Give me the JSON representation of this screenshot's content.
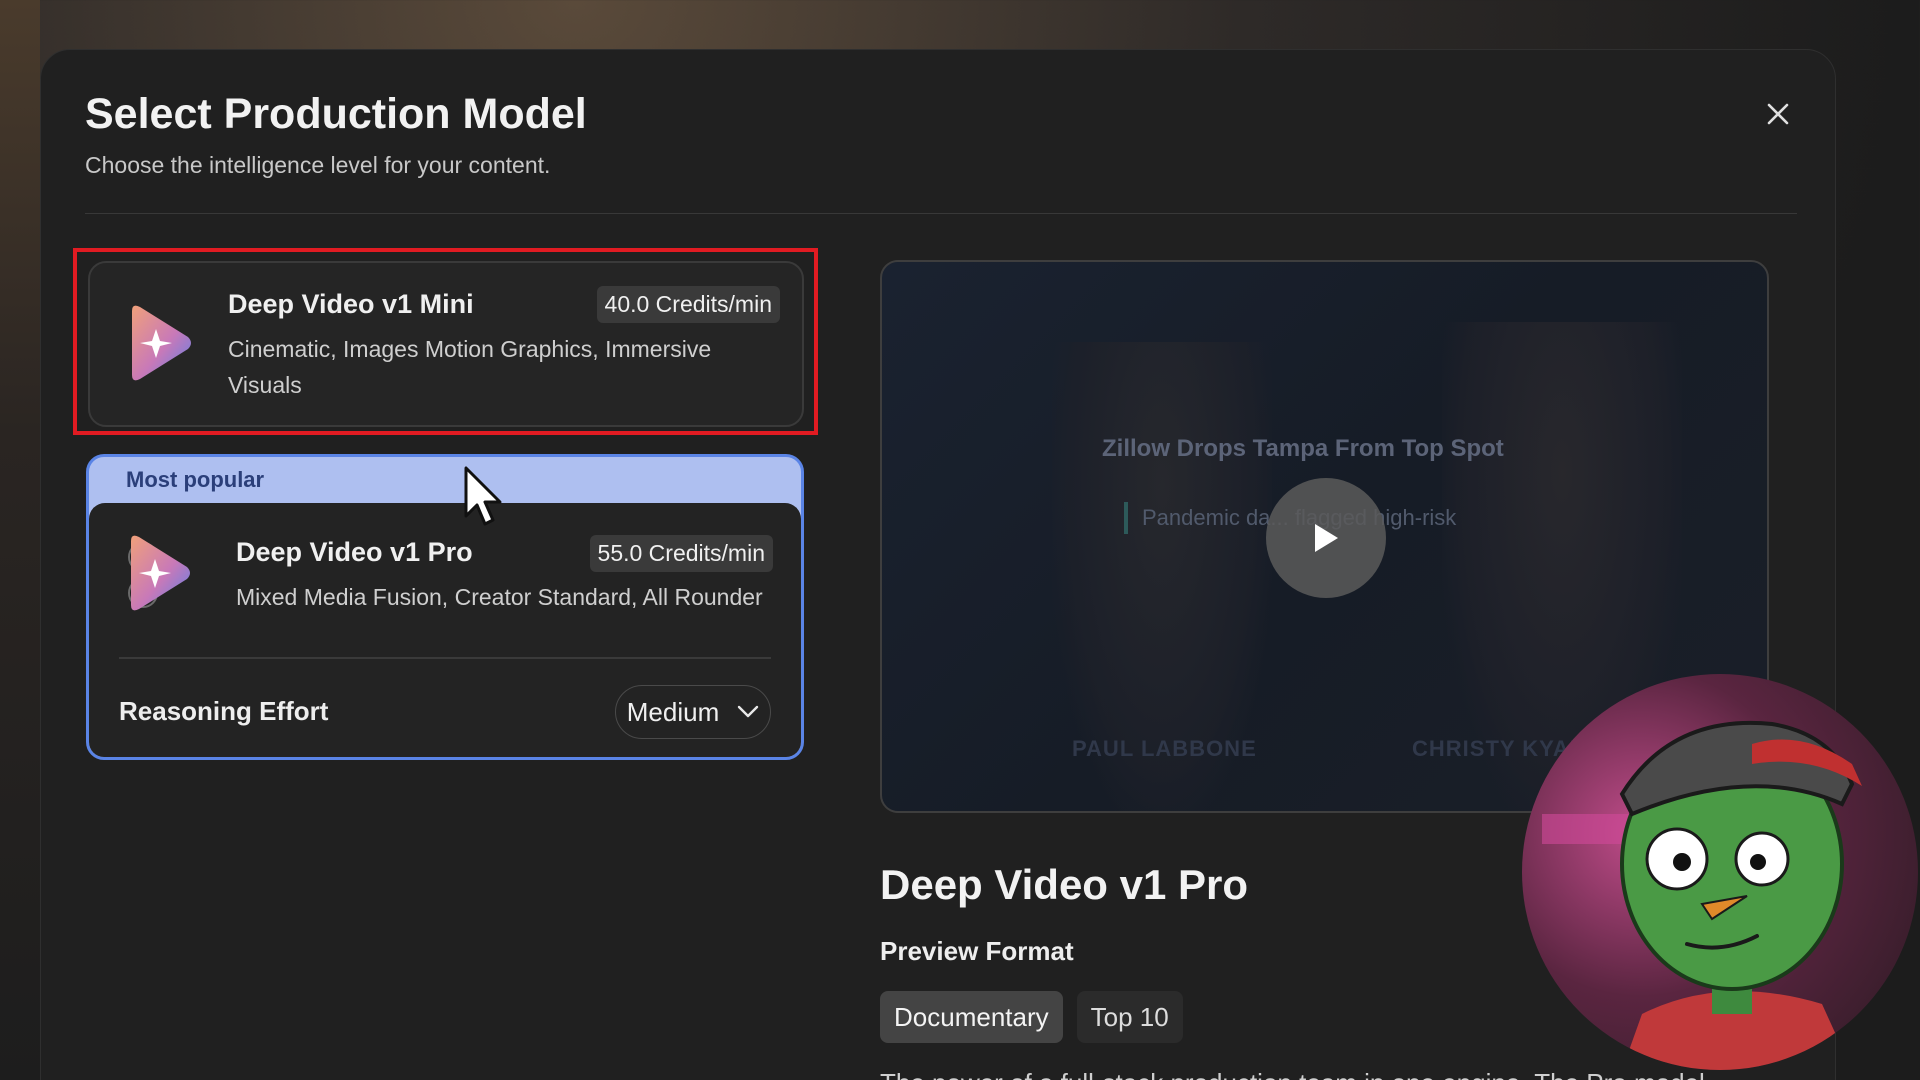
{
  "modal": {
    "title": "Select Production Model",
    "subtitle": "Choose the intelligence level for your content."
  },
  "models": [
    {
      "name": "Deep Video v1 Mini",
      "credits": "40.0 Credits/min",
      "description": "Cinematic, Images Motion Graphics, Immersive Visuals",
      "icon": "sparkle-play-icon"
    },
    {
      "badge": "Most popular",
      "name": "Deep Video v1 Pro",
      "credits": "55.0 Credits/min",
      "description": "Mixed Media Fusion, Creator Standard, All Rounder",
      "icon": "sparkle-play-icon",
      "reasoning_label": "Reasoning Effort",
      "reasoning_value": "Medium"
    }
  ],
  "preview": {
    "video_headline": "Zillow Drops Tampa From Top Spot",
    "video_subtext": "Pandemic da... flagged high-risk",
    "video_lower_left": "PAUL LABBONE",
    "video_lower_right": "CHRISTY KYAR",
    "selected_model": "Deep Video v1 Pro",
    "section_label": "Preview Format",
    "formats": [
      "Documentary",
      "Top 10"
    ],
    "active_format": "Documentary",
    "description": "The power of a full-stack production team in one engine. The Pro model"
  },
  "colors": {
    "highlight": "#e11b22",
    "popular_bg": "#aebff0",
    "popular_border": "#5a84e6",
    "popular_text": "#2b3f7a",
    "modal_bg": "#202020"
  }
}
